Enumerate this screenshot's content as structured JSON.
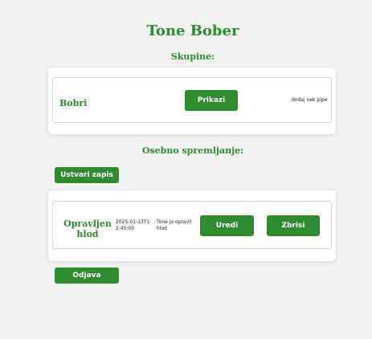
{
  "user": {
    "name": "Tone Bober"
  },
  "groups": {
    "heading": "Skupine:",
    "items": [
      {
        "name": "Bobri",
        "show_label": "Prikazi",
        "note": "dodaj nek pipe"
      }
    ]
  },
  "personal": {
    "heading": "Osebno spremljanje:",
    "create_label": "Ustvari zapis",
    "entries": [
      {
        "title": "Opravljen hlod",
        "timestamp": "2025-01-13T12:45:00",
        "description": "Tone je opravil hlod",
        "edit_label": "Uredi",
        "delete_label": "Zbrisi"
      }
    ]
  },
  "logout_label": "Odjava",
  "colors": {
    "accent": "#2e8b2e",
    "background": "#f2f2f2",
    "card": "#ffffff"
  }
}
